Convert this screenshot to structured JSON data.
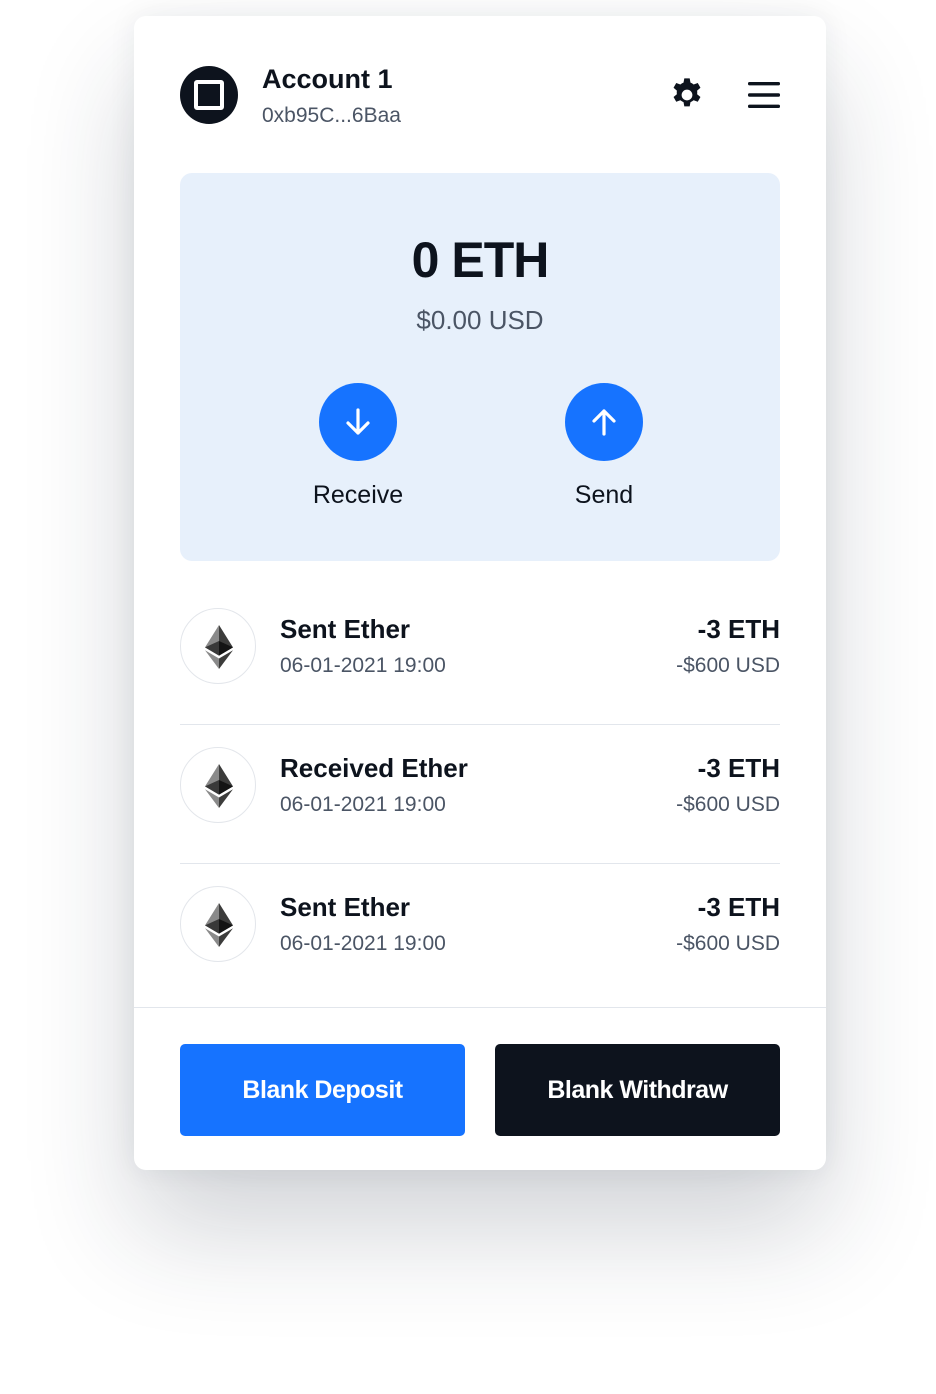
{
  "account": {
    "name": "Account 1",
    "address": "0xb95C...6Baa"
  },
  "header": {
    "settings_icon": "gear-icon",
    "menu_icon": "hamburger-menu-icon"
  },
  "balance": {
    "amount": "0 ETH",
    "usd": "$0.00 USD"
  },
  "actions": [
    {
      "label": "Receive",
      "icon": "arrow-down-icon"
    },
    {
      "label": "Send",
      "icon": "arrow-up-icon"
    }
  ],
  "transactions": [
    {
      "title": "Sent Ether",
      "date": "06-01-2021 19:00",
      "amount": "-3 ETH",
      "usd": "-$600 USD",
      "icon": "ethereum-icon"
    },
    {
      "title": "Received Ether",
      "date": "06-01-2021 19:00",
      "amount": "-3 ETH",
      "usd": "-$600 USD",
      "icon": "ethereum-icon"
    },
    {
      "title": "Sent Ether",
      "date": "06-01-2021 19:00",
      "amount": "-3 ETH",
      "usd": "-$600 USD",
      "icon": "ethereum-icon"
    }
  ],
  "footer": {
    "deposit_label": "Blank Deposit",
    "withdraw_label": "Blank Withdraw"
  },
  "colors": {
    "accent": "#1673ff",
    "dark": "#0d131d",
    "panel": "#e7f0fb"
  }
}
